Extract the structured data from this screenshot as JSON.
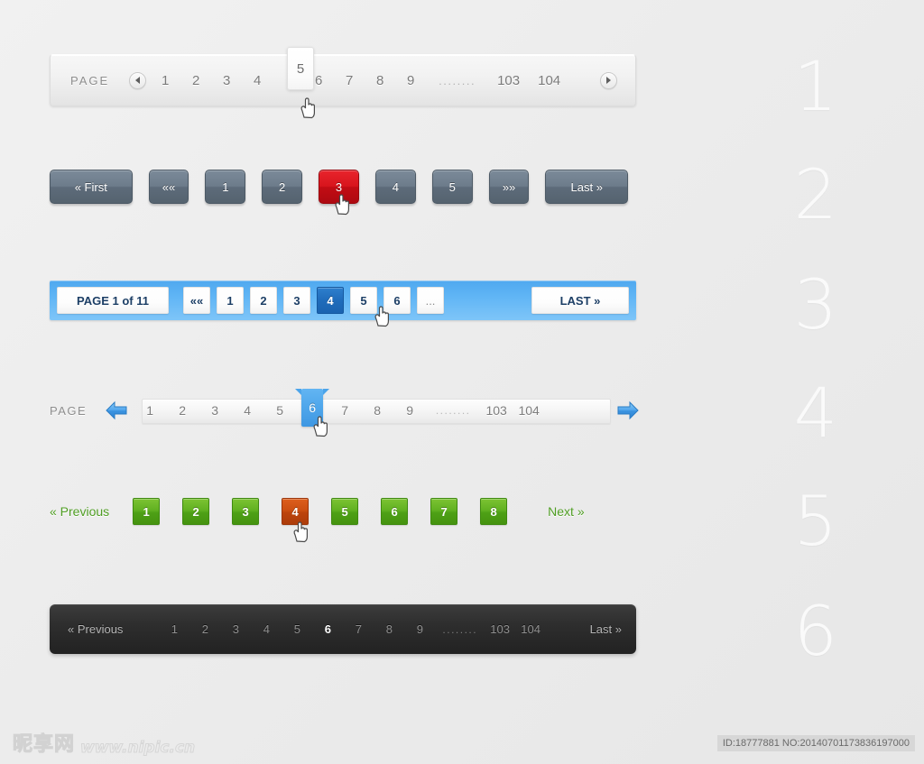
{
  "section_numbers": [
    "1",
    "2",
    "3",
    "4",
    "5",
    "6"
  ],
  "widget1": {
    "name": "light-gray-bar-pagination",
    "label": "PAGE",
    "prev_icon": "triangle-left-icon",
    "next_icon": "triangle-right-icon",
    "pages": [
      "1",
      "2",
      "3",
      "4",
      "5",
      "6",
      "7",
      "8",
      "9"
    ],
    "ellipsis": "........",
    "tail_pages": [
      "103",
      "104"
    ],
    "active": "5",
    "colors": {
      "bar": "#f2f2f2",
      "text": "#7b7b7b",
      "active_bg": "#ffffff"
    }
  },
  "widget2": {
    "name": "slate-3d-button-pagination",
    "first_label": "« First",
    "prev_label": "««",
    "pages": [
      "1",
      "2",
      "3",
      "4",
      "5"
    ],
    "next_label": "»»",
    "last_label": "Last »",
    "active": "3",
    "colors": {
      "button": "#6d7c8b",
      "active": "#d8151d",
      "text": "#ffffff"
    }
  },
  "widget3": {
    "name": "blue-strip-pagination",
    "page_label": "PAGE 1 of 11",
    "prev_label": "««",
    "pages": [
      "1",
      "2",
      "3",
      "4",
      "5",
      "6"
    ],
    "ellipsis": "...",
    "last_label": "LAST »",
    "active": "4",
    "colors": {
      "bar": "#60b5f5",
      "tile": "#ffffff",
      "tile_text": "#1d3f66",
      "active": "#1f6cbb"
    }
  },
  "widget4": {
    "name": "slim-strip-slider-pagination",
    "label": "PAGE",
    "prev_icon": "arrow-left-icon",
    "next_icon": "arrow-right-icon",
    "pages": [
      "1",
      "2",
      "3",
      "4",
      "5",
      "6",
      "7",
      "8",
      "9"
    ],
    "ellipsis": "........",
    "tail_pages": [
      "103",
      "104"
    ],
    "active": "6",
    "colors": {
      "strip": "#f6f6f6",
      "active": "#4fa6eb",
      "arrow": "#3e97e2"
    }
  },
  "widget5": {
    "name": "green-tile-pagination",
    "prev_label": "« Previous",
    "next_label": "Next »",
    "pages": [
      "1",
      "2",
      "3",
      "4",
      "5",
      "6",
      "7",
      "8"
    ],
    "active": "4",
    "colors": {
      "tile": "#61b121",
      "active": "#cc4f12",
      "link_text": "#4f9e23"
    }
  },
  "widget6": {
    "name": "dark-bar-pagination",
    "prev_label": "« Previous",
    "pages": [
      "1",
      "2",
      "3",
      "4",
      "5",
      "6",
      "7",
      "8",
      "9"
    ],
    "ellipsis": "........",
    "tail_pages": [
      "103",
      "104"
    ],
    "last_label": "Last »",
    "active": "6",
    "colors": {
      "bar": "#2e2e2e",
      "text": "#8f8f8f",
      "active_text": "#ffffff"
    }
  },
  "footer": {
    "watermark_cn": "昵享网",
    "watermark_url": "www.nipic.cn",
    "id_text": "ID:18777881 NO:20140701173836197000"
  }
}
